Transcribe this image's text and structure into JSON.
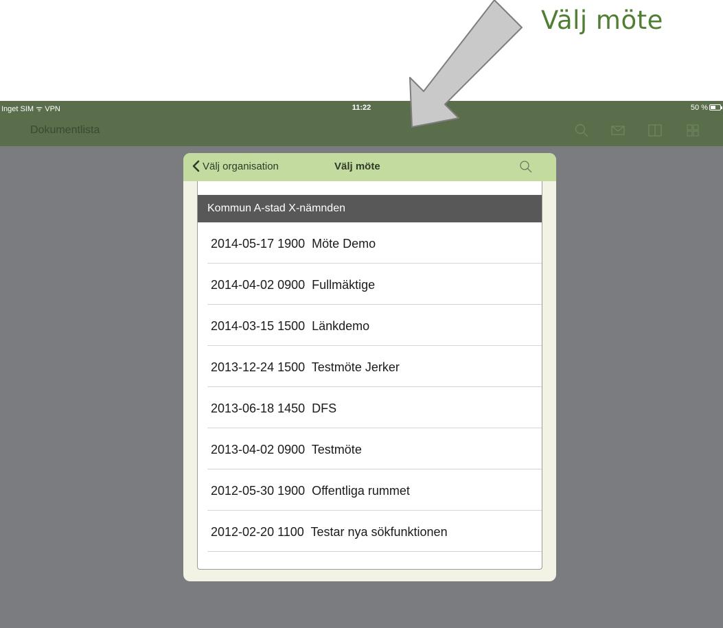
{
  "annotation": {
    "caption": "Välj möte"
  },
  "status_bar": {
    "carrier": "Inget SIM ᯤ VPN",
    "time": "11:22",
    "battery": "50 %"
  },
  "nav_bar": {
    "title": "Dokumentlista",
    "icons": [
      "search-icon",
      "mail-icon",
      "book-icon",
      "grid-icon"
    ]
  },
  "popover": {
    "back_label": "Välj organisation",
    "title": "Välj möte",
    "section_header": "Kommun A-stad X-nämnden",
    "meetings": [
      {
        "label": "2014-05-17 1900  Möte Demo"
      },
      {
        "label": "2014-04-02 0900  Fullmäktige"
      },
      {
        "label": "2014-03-15 1500  Länkdemo"
      },
      {
        "label": "2013-12-24 1500  Testmöte Jerker"
      },
      {
        "label": "2013-06-18 1450  DFS"
      },
      {
        "label": "2013-04-02 0900  Testmöte"
      },
      {
        "label": "2012-05-30 1900  Offentliga rummet"
      },
      {
        "label": "2012-02-20 1100  Testar nya sökfunktionen"
      }
    ]
  },
  "colors": {
    "nav": "#5a6e4b",
    "popover_header": "#c4db9f",
    "section": "#585858",
    "caption": "#4f7f33"
  }
}
